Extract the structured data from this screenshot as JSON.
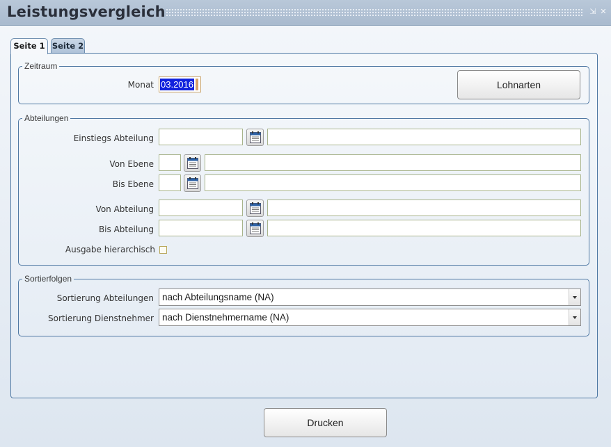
{
  "window": {
    "title": "Leistungsvergleich",
    "minimize_glyph": "⇲",
    "close_glyph": "✕"
  },
  "tabs": [
    {
      "label": "Seite 1",
      "active": true
    },
    {
      "label": "Seite 2",
      "active": false
    }
  ],
  "zeitraum": {
    "legend": "Zeitraum",
    "monat_label": "Monat",
    "monat_value": "03.2016",
    "lohnarten_button": "Lohnarten"
  },
  "abteilungen": {
    "legend": "Abteilungen",
    "einstiegs_label": "Einstiegs Abteilung",
    "einstiegs_code": "",
    "einstiegs_name": "",
    "von_ebene_label": "Von Ebene",
    "von_ebene_value": "",
    "von_ebene_name": "",
    "bis_ebene_label": "Bis Ebene",
    "bis_ebene_value": "",
    "bis_ebene_name": "",
    "von_abteilung_label": "Von Abteilung",
    "von_abteilung_code": "",
    "von_abteilung_name": "",
    "bis_abteilung_label": "Bis Abteilung",
    "bis_abteilung_code": "",
    "bis_abteilung_name": "",
    "hierarchisch_label": "Ausgabe hierarchisch",
    "hierarchisch_checked": false
  },
  "sortierfolgen": {
    "legend": "Sortierfolgen",
    "abteilungen_label": "Sortierung Abteilungen",
    "abteilungen_value": "nach Abteilungsname (NA)",
    "dienstnehmer_label": "Sortierung Dienstnehmer",
    "dienstnehmer_value": "nach Dienstnehmername (NA)"
  },
  "footer": {
    "drucken_button": "Drucken"
  },
  "icons": {
    "lookup": "calendar-list-icon",
    "dropdown": "chevron-down-icon"
  },
  "colors": {
    "titlebar": "#b0c1d4",
    "border_accent": "#4f78a3",
    "selection": "#1122dd"
  }
}
